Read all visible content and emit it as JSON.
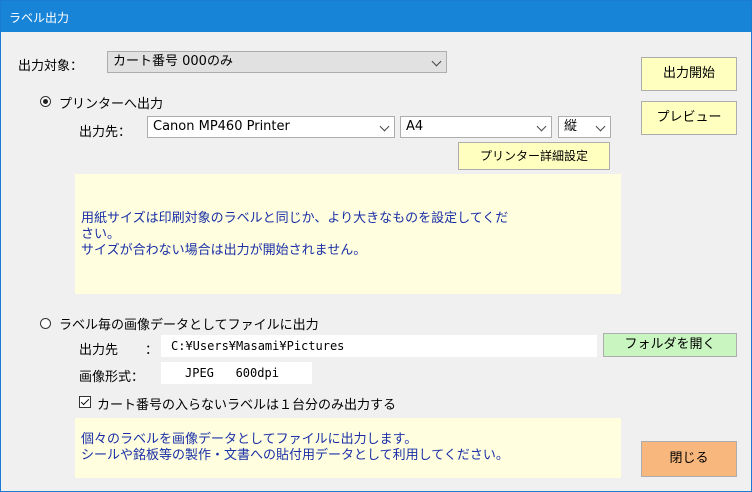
{
  "window": {
    "title": "ラベル出力"
  },
  "target": {
    "label": "出力対象：",
    "selected": "カート番号 000のみ"
  },
  "printer": {
    "radio_label": "プリンターへ出力",
    "selected": true,
    "dest_label": "出力先：",
    "printer_name": "Canon MP460 Printer",
    "paper": "A4",
    "orientation": "縦",
    "details_button": "プリンター詳細設定",
    "note_line1": "用紙サイズは印刷対象のラベルと同じか、より大きなものを設定してくだ",
    "note_line2": "さい。",
    "note_line3": "サイズが合わない場合は出力が開始されません。"
  },
  "image": {
    "radio_label": "ラベル毎の画像データとしてファイルに出力",
    "selected": false,
    "dest_label": "出力先",
    "dest_colon": "：",
    "path": "C:¥Users¥Masami¥Pictures",
    "open_folder_button": "フォルダを開く",
    "format_label": "画像形式：",
    "format_value": "JPEG   600dpi",
    "checkbox_label": "カート番号の入らないラベルは１台分のみ出力する",
    "checkbox_checked": true,
    "note_line1": "個々のラベルを画像データとしてファイルに出力します。",
    "note_line2": "シールや銘板等の製作・文書への貼付用データとして利用してください。"
  },
  "actions": {
    "start_button": "出力開始",
    "preview_button": "プレビュー",
    "close_button": "閉じる"
  }
}
